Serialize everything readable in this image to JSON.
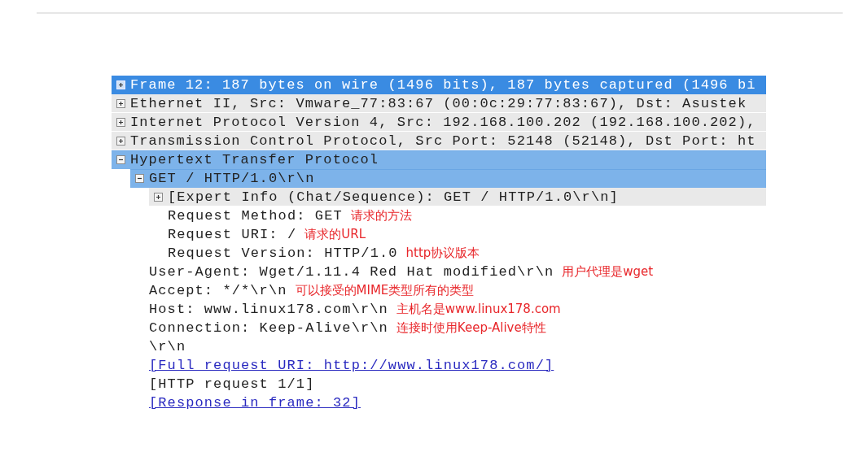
{
  "packet_details": {
    "rows": [
      {
        "text": "Frame 12: 187 bytes on wire (1496 bits), 187 bytes captured (1496 bi",
        "kind": "text",
        "selected": true,
        "highlighted": false,
        "shaded": false,
        "expanded": false
      },
      {
        "text": "Ethernet II, Src: Vmware_77:83:67 (00:0c:29:77:83:67), Dst: Asustek",
        "kind": "text",
        "selected": false,
        "highlighted": false,
        "shaded": true,
        "expanded": false
      },
      {
        "text": "Internet Protocol Version 4, Src: 192.168.100.202 (192.168.100.202),",
        "kind": "text",
        "selected": false,
        "highlighted": false,
        "shaded": true,
        "expanded": false
      },
      {
        "text": "Transmission Control Protocol, Src Port: 52148 (52148), Dst Port: ht",
        "kind": "text",
        "selected": false,
        "highlighted": false,
        "shaded": true,
        "expanded": false
      },
      {
        "text": "Hypertext Transfer Protocol",
        "kind": "text",
        "selected": false,
        "highlighted": true,
        "shaded": false,
        "expanded": true,
        "children": [
          {
            "text": "GET / HTTP/1.0\\r\\n",
            "kind": "text",
            "selected": false,
            "highlighted": true,
            "shaded": false,
            "expanded": true,
            "children": [
              {
                "text": "[Expert Info (Chat/Sequence): GET / HTTP/1.0\\r\\n]",
                "kind": "text",
                "selected": false,
                "highlighted": false,
                "shaded": true,
                "expanded": false
              },
              {
                "text": "Request Method: GET",
                "note": "请求的方法",
                "kind": "text",
                "selected": false,
                "highlighted": false,
                "shaded": false
              },
              {
                "text": "Request URI: /",
                "note": "请求的URL",
                "kind": "text",
                "selected": false,
                "highlighted": false,
                "shaded": false
              },
              {
                "text": "Request Version: HTTP/1.0",
                "note": "http协议版本",
                "kind": "text",
                "selected": false,
                "highlighted": false,
                "shaded": false
              }
            ]
          },
          {
            "text": "User-Agent: Wget/1.11.4 Red Hat modified\\r\\n",
            "note": "用户代理是wget",
            "kind": "text",
            "selected": false,
            "highlighted": false,
            "shaded": false
          },
          {
            "text": "Accept: */*\\r\\n",
            "note": "可以接受的MIME类型所有的类型",
            "kind": "text",
            "selected": false,
            "highlighted": false,
            "shaded": false
          },
          {
            "text": "Host: www.linux178.com\\r\\n",
            "note": "主机名是www.linux178.com",
            "kind": "text",
            "selected": false,
            "highlighted": false,
            "shaded": false
          },
          {
            "text": "Connection: Keep-Alive\\r\\n",
            "note": "连接时使用Keep-Alive特性",
            "kind": "text",
            "selected": false,
            "highlighted": false,
            "shaded": false
          },
          {
            "text": "\\r\\n",
            "kind": "text",
            "selected": false,
            "highlighted": false,
            "shaded": false
          },
          {
            "text": "[Full request URI: http://www.linux178.com/]",
            "kind": "link",
            "selected": false,
            "highlighted": false,
            "shaded": false
          },
          {
            "text": "[HTTP request 1/1]",
            "kind": "text",
            "selected": false,
            "highlighted": false,
            "shaded": false
          },
          {
            "text": "[Response in frame: 32]",
            "kind": "link",
            "selected": false,
            "highlighted": false,
            "shaded": false
          }
        ]
      }
    ]
  }
}
